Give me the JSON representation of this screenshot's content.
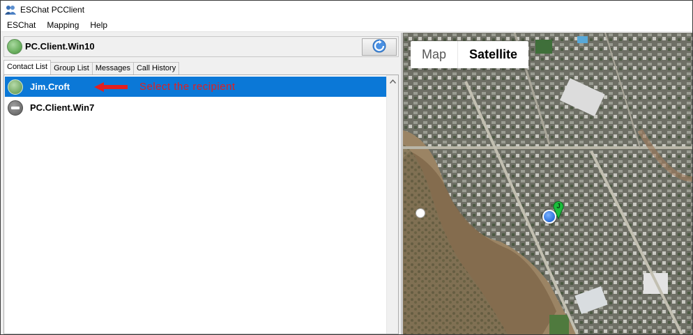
{
  "window": {
    "title": "ESChat PCClient"
  },
  "menu": {
    "items": [
      "ESChat",
      "Mapping",
      "Help"
    ]
  },
  "status": {
    "user": "PC.Client.Win10"
  },
  "tabs": [
    "Contact List",
    "Group List",
    "Messages",
    "Call History"
  ],
  "contacts": [
    {
      "name": "Jim.Croft",
      "status": "online",
      "selected": true
    },
    {
      "name": "PC.Client.Win7",
      "status": "unavailable",
      "selected": false
    }
  ],
  "annotation": {
    "text": "Select the recipient",
    "color": "#e21f1f"
  },
  "map": {
    "type_options": [
      "Map",
      "Satellite"
    ],
    "selected_type": "Satellite",
    "marker_label": "J"
  },
  "colors": {
    "selection": "#0b78d7",
    "online": "#7cae6d"
  }
}
